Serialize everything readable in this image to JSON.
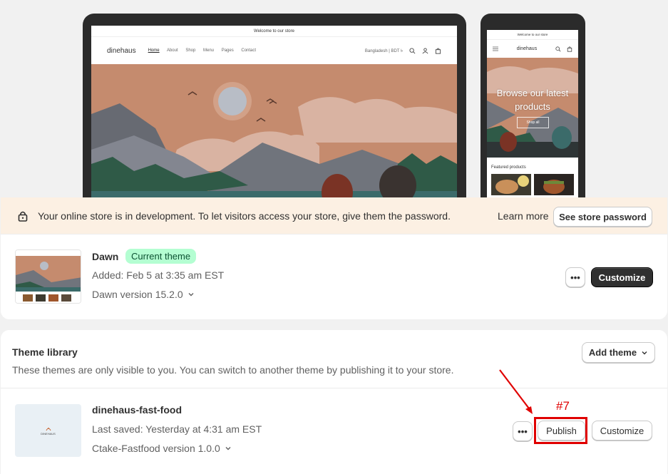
{
  "preview": {
    "desktop": {
      "announcement": "Welcome to our store",
      "logo": "dinehaus",
      "nav": [
        "Home",
        "About",
        "Shop",
        "Menu",
        "Pages",
        "Contact"
      ],
      "locale": "Bangladesh | BDT ৳"
    },
    "mobile": {
      "announcement": "Welcome to our store",
      "logo": "dinehaus",
      "hero_title": "Browse our latest products",
      "hero_button": "Shop all",
      "featured": "Featured products"
    }
  },
  "banner": {
    "text": "Your online store is in development. To let visitors access your store, give them the password.",
    "learn_more": "Learn more",
    "button": "See store password"
  },
  "current_theme": {
    "name": "Dawn",
    "badge": "Current theme",
    "added": "Added: Feb 5 at 3:35 am EST",
    "version": "Dawn version 15.2.0",
    "more_label": "•••",
    "customize": "Customize"
  },
  "library": {
    "title": "Theme library",
    "subtitle": "These themes are only visible to you. You can switch to another theme by publishing it to your store.",
    "add_theme": "Add theme",
    "themes": [
      {
        "name": "dinehaus-fast-food",
        "thumb_logo": "DINEHAUS",
        "saved": "Last saved: Yesterday at 4:31 am EST",
        "version": "Ctake-Fastfood version 1.0.0",
        "more_label": "•••",
        "publish": "Publish",
        "customize": "Customize"
      }
    ]
  },
  "annotation": {
    "label": "#7",
    "color": "#e00000"
  },
  "colors": {
    "banner_bg": "#fcf0e3",
    "badge_bg": "#b4fed2",
    "primary_button": "#303030"
  }
}
